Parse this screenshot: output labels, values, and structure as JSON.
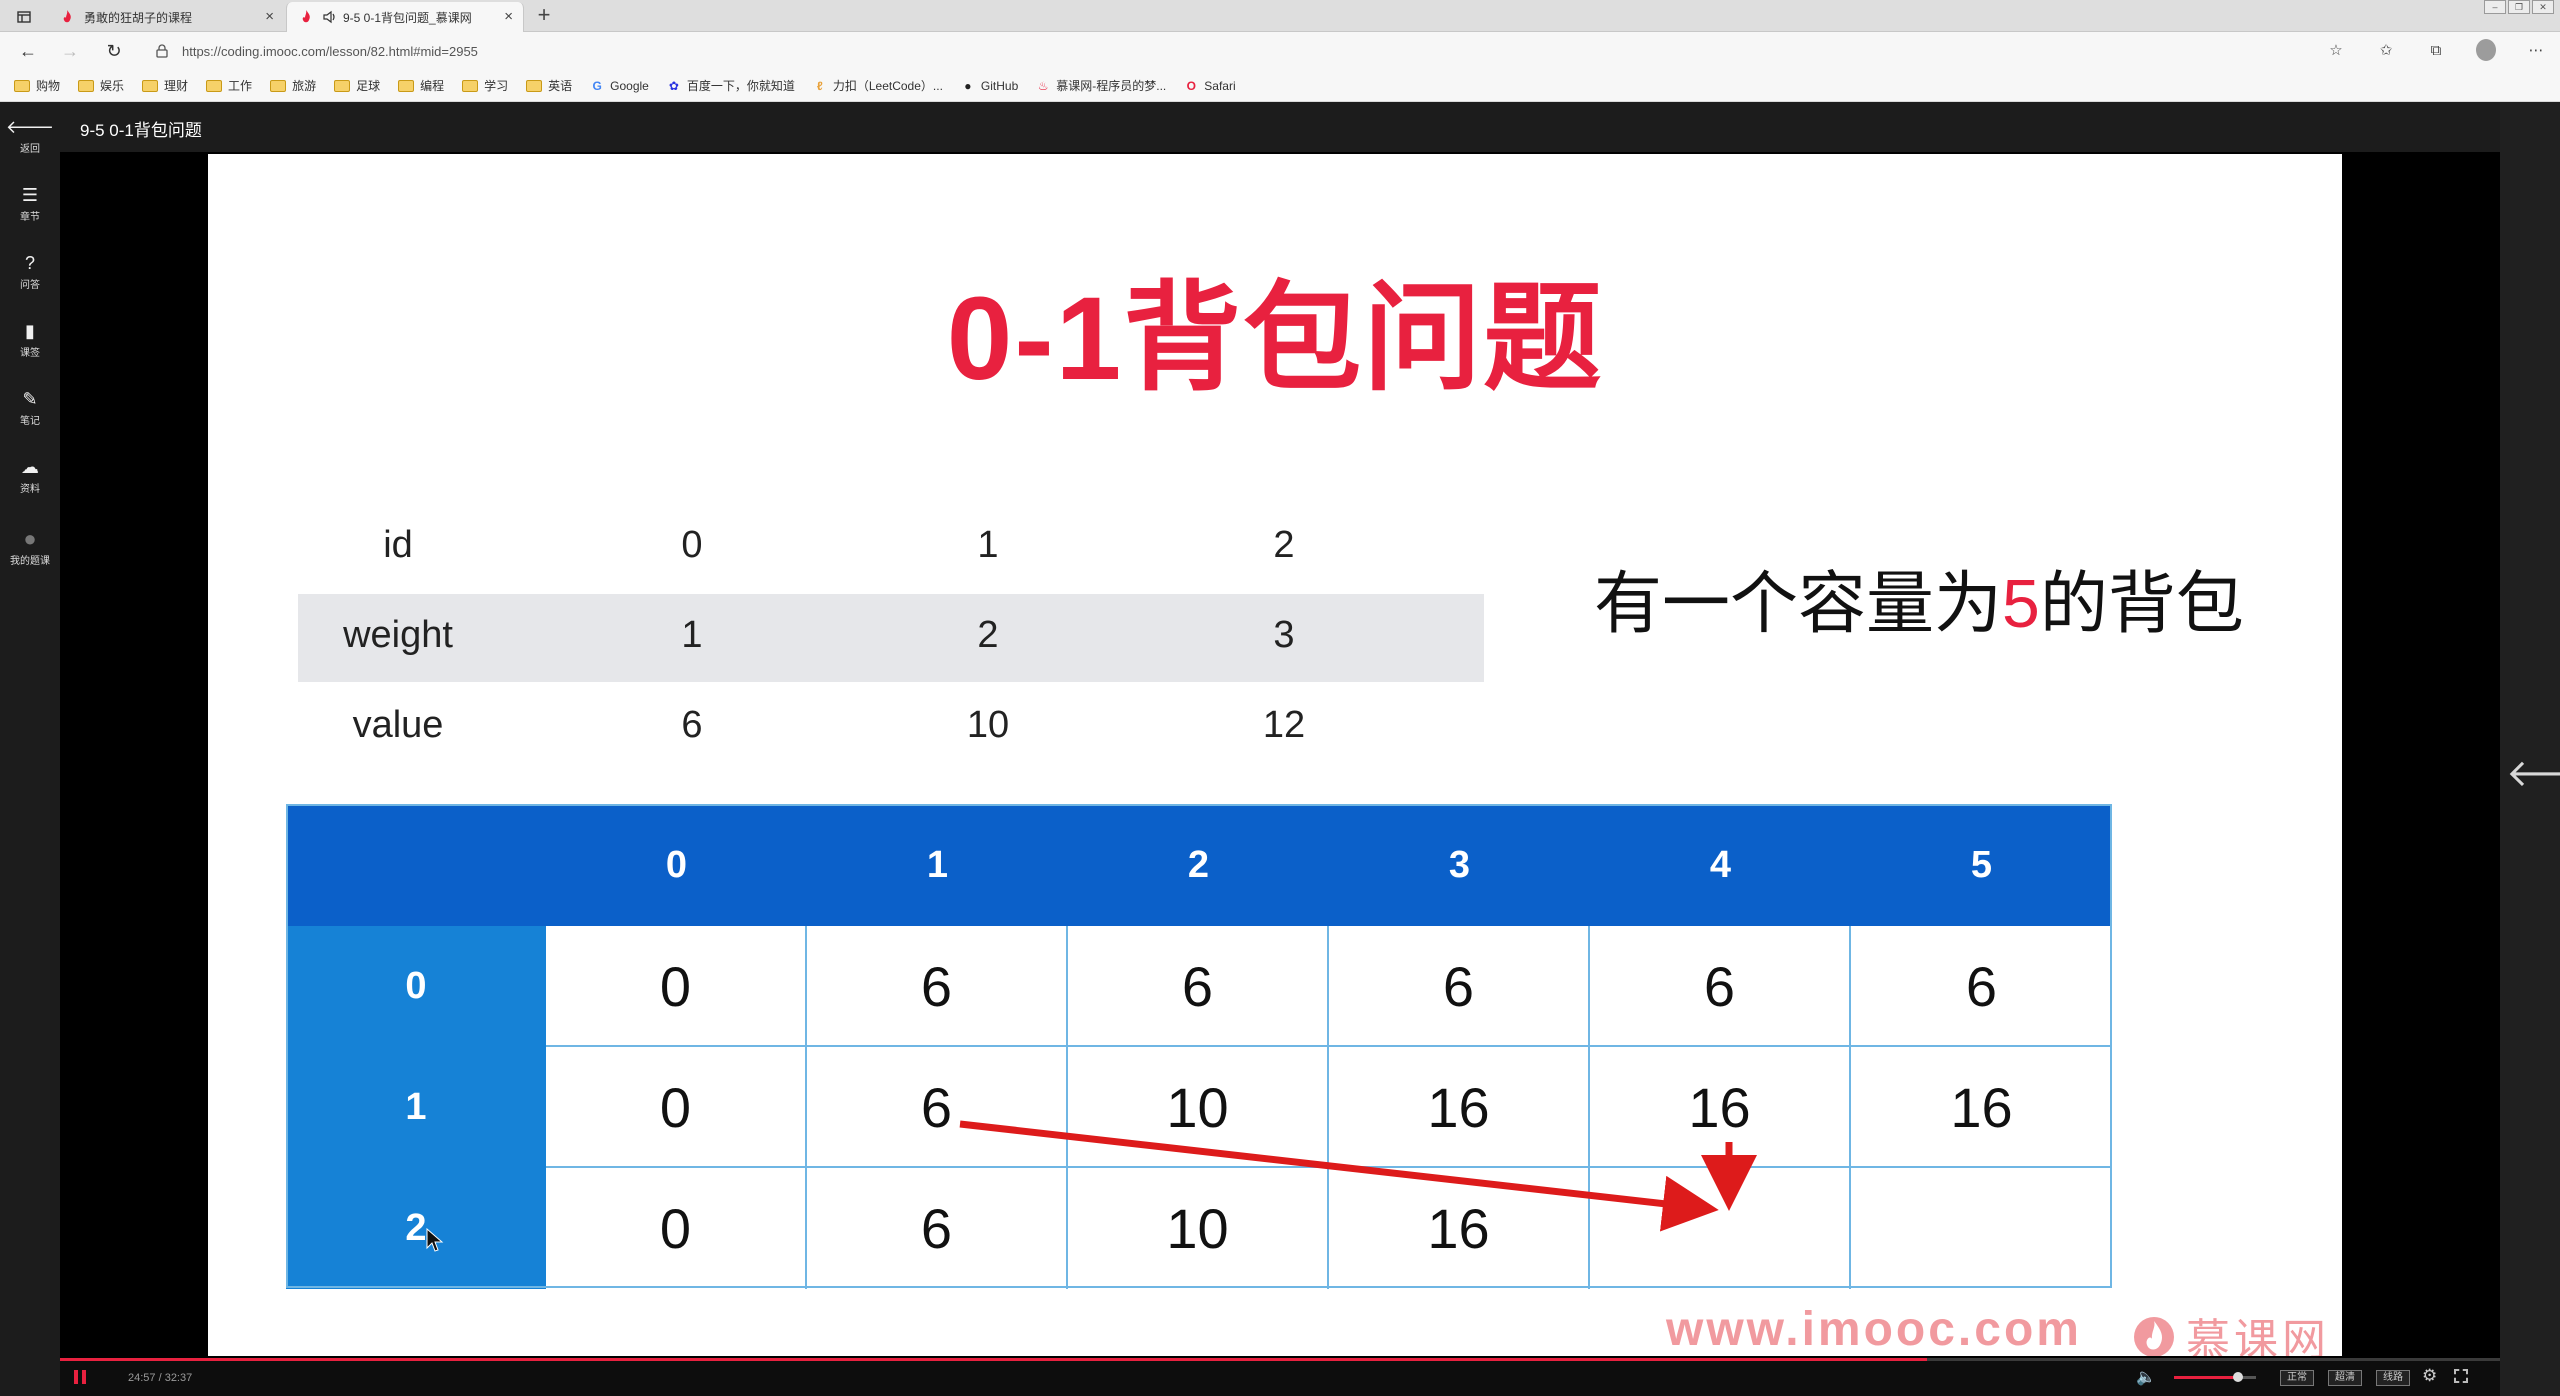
{
  "browser": {
    "tabs": [
      {
        "title": "勇敢的狂胡子的课程",
        "active": false
      },
      {
        "title": "9-5 0-1背包问题_慕课网",
        "active": true
      }
    ],
    "url": "https://coding.imooc.com/lesson/82.html#mid=2955",
    "bookmarks": [
      {
        "label": "购物",
        "type": "folder"
      },
      {
        "label": "娱乐",
        "type": "folder"
      },
      {
        "label": "理财",
        "type": "folder"
      },
      {
        "label": "工作",
        "type": "folder"
      },
      {
        "label": "旅游",
        "type": "folder"
      },
      {
        "label": "足球",
        "type": "folder"
      },
      {
        "label": "编程",
        "type": "folder"
      },
      {
        "label": "学习",
        "type": "folder"
      },
      {
        "label": "英语",
        "type": "folder"
      },
      {
        "label": "Google",
        "type": "google"
      },
      {
        "label": "百度一下，你就知道",
        "type": "baidu"
      },
      {
        "label": "力扣（LeetCode）...",
        "type": "leetcode"
      },
      {
        "label": "GitHub",
        "type": "github"
      },
      {
        "label": "慕课网-程序员的梦...",
        "type": "imooc"
      },
      {
        "label": "Safari",
        "type": "opera"
      }
    ]
  },
  "left_nav": [
    {
      "label": "返回",
      "icon": "back-arrow-icon"
    },
    {
      "label": "章节",
      "icon": "menu-icon"
    },
    {
      "label": "问答",
      "icon": "question-icon"
    },
    {
      "label": "课签",
      "icon": "bookmark-icon"
    },
    {
      "label": "笔记",
      "icon": "pencil-icon"
    },
    {
      "label": "资料",
      "icon": "cloud-download-icon"
    },
    {
      "label": "我的题课",
      "icon": "user-avatar-icon"
    }
  ],
  "lesson": {
    "title": "9-5 0-1背包问题"
  },
  "slide": {
    "title": "0-1背包问题",
    "items_table": {
      "header": {
        "label": "id",
        "cols": [
          "0",
          "1",
          "2"
        ]
      },
      "rows": [
        {
          "label": "weight",
          "values": [
            "1",
            "2",
            "3"
          ]
        },
        {
          "label": "value",
          "values": [
            "6",
            "10",
            "12"
          ]
        }
      ]
    },
    "statement": {
      "before": "有一个容量为",
      "capacity": "5",
      "after": "的背包"
    },
    "dp_table": {
      "col_headers": [
        "0",
        "1",
        "2",
        "3",
        "4",
        "5"
      ],
      "row_headers": [
        "0",
        "1",
        "2"
      ],
      "cells": [
        [
          "0",
          "6",
          "6",
          "6",
          "6",
          "6"
        ],
        [
          "0",
          "6",
          "10",
          "16",
          "16",
          "16"
        ],
        [
          "0",
          "6",
          "10",
          "16",
          "",
          ""
        ]
      ]
    },
    "watermark": "www.imooc.com",
    "watermark_logo_text": "慕课网"
  },
  "player": {
    "time_display": "24:57 / 32:37",
    "progress_fraction": 0.765,
    "volume_fraction": 0.78,
    "quality_buttons": [
      "正常",
      "超清",
      "线路"
    ]
  },
  "colors": {
    "accent_red": "#e8213f",
    "table_header_blue": "#0b60c9",
    "row_header_blue": "#1682d6"
  }
}
